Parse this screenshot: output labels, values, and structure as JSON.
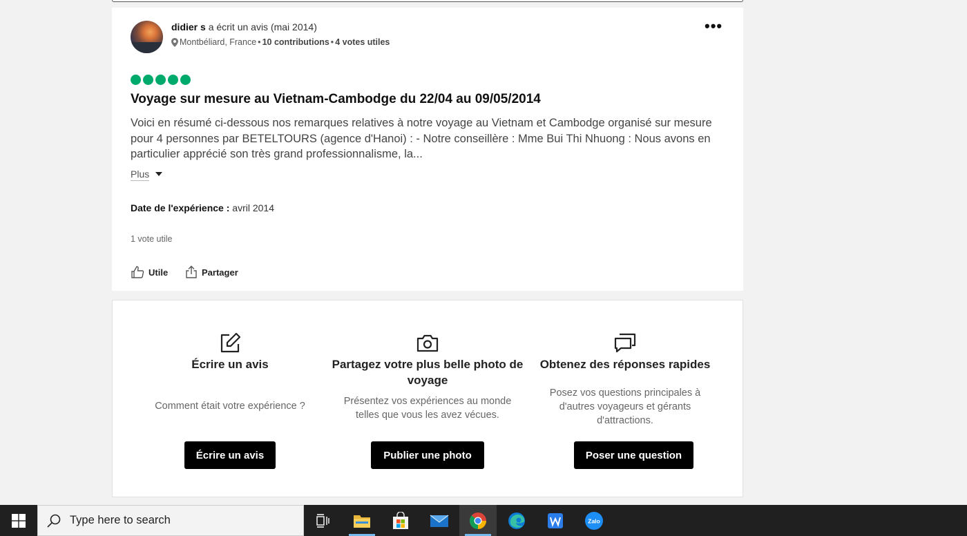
{
  "review": {
    "author_name": "didier s",
    "author_action": "a écrit un avis (mai 2014)",
    "location": "Montbéliard, France",
    "separator": "•",
    "contributions_count": "10 contributions",
    "helpful_votes_profile": "4 votes utiles",
    "rating": 5,
    "rating_color": "#00aa6c",
    "title": "Voyage sur mesure au Vietnam-Cambodge du 22/04 au 09/05/2014",
    "body": "Voici en résumé ci-dessous nos remarques relatives à notre voyage au Vietnam et Cambodge organisé sur mesure pour 4 personnes par BETELTOURS (agence d'Hanoi) : - Notre conseillère : Mme Bui Thi Nhuong : Nous avons en particulier apprécié son très grand professionnalisme, la...",
    "more_label": "Plus",
    "experience_label": "Date de l'expérience :",
    "experience_value": "avril 2014",
    "votes_label": "1 vote utile",
    "helpful_button": "Utile",
    "share_button": "Partager"
  },
  "contribute": [
    {
      "icon": "pencil-square-icon",
      "title": "Écrire un avis",
      "text": "Comment était votre expérience ?",
      "button": "Écrire un avis"
    },
    {
      "icon": "camera-icon",
      "title": "Partagez votre plus belle photo de voyage",
      "text": "Présentez vos expériences au monde telles que vous les avez vécues.",
      "button": "Publier une photo"
    },
    {
      "icon": "chat-bubbles-icon",
      "title": "Obtenez des réponses rapides",
      "text": "Posez vos questions principales à d'autres voyageurs et gérants d'attractions.",
      "button": "Poser une question"
    }
  ],
  "taskbar": {
    "search_placeholder": "Type here to search",
    "apps": [
      "task-view-icon",
      "file-explorer-icon",
      "microsoft-store-icon",
      "mail-icon",
      "chrome-icon",
      "edge-icon",
      "wps-office-icon",
      "zalo-icon"
    ],
    "active_app": "chrome-icon",
    "zalo_label": "Zalo"
  }
}
